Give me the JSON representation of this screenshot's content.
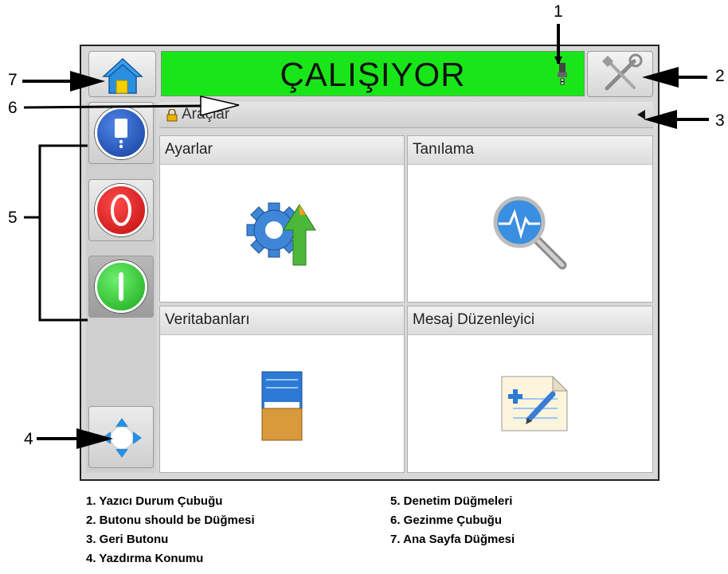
{
  "status_bar": {
    "text": "ÇALIŞIYOR"
  },
  "nav_bar": {
    "breadcrumb": "Araçlar"
  },
  "tiles": [
    {
      "label": "Ayarlar",
      "icon": "settings-icon"
    },
    {
      "label": "Tanılama",
      "icon": "diagnostics-icon"
    },
    {
      "label": "Veritabanları",
      "icon": "database-folder-icon"
    },
    {
      "label": "Mesaj Düzenleyici",
      "icon": "message-editor-icon"
    }
  ],
  "callouts": [
    "1",
    "2",
    "3",
    "4",
    "5",
    "6",
    "7"
  ],
  "legend": [
    "1. Yazıcı Durum Çubuğu",
    "2. Butonu should be Düğmesi",
    "3. Geri Butonu",
    "4. Yazdırma Konumu",
    "5. Denetim Düğmeleri",
    "6. Gezinme Çubuğu",
    "7. Ana Sayfa Düğmesi"
  ],
  "colors": {
    "status_running": "#19e619",
    "stop_red": "#e01818",
    "start_green": "#2fd12f",
    "info_blue": "#1f4fb0"
  }
}
